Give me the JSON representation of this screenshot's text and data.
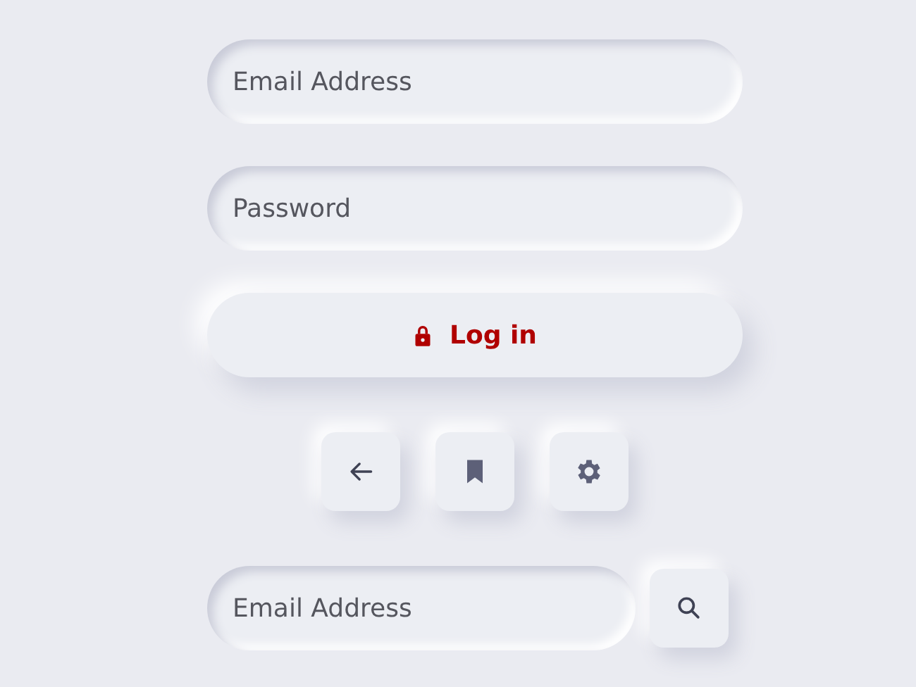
{
  "login_form": {
    "fields": [
      {
        "placeholder": "Email Address"
      },
      {
        "placeholder": "Password"
      }
    ],
    "submit": {
      "label": "Log in"
    }
  },
  "icon_buttons": [
    {
      "kind": "back"
    },
    {
      "kind": "bookmark"
    },
    {
      "kind": "settings"
    }
  ],
  "search": {
    "placeholder": "Email Address"
  }
}
